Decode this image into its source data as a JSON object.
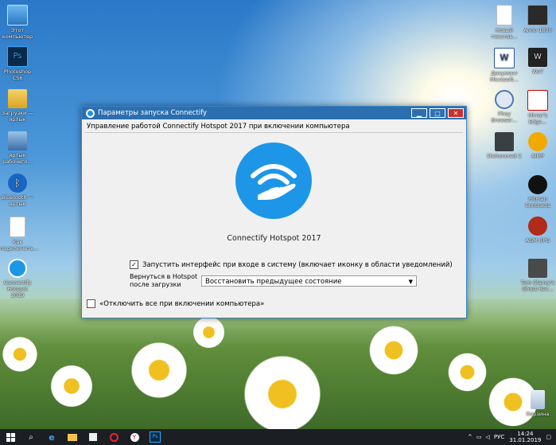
{
  "desktop": {
    "left_icons": [
      {
        "label": "Этот компьютер",
        "icon": "computer-icon"
      },
      {
        "label": "Photoshop CS6",
        "icon": "photoshop-icon"
      },
      {
        "label": "Загрузки — ярлык",
        "icon": "downloads-icon"
      },
      {
        "label": "ярлык рабочего…",
        "icon": "shortcut-icon"
      },
      {
        "label": "Bluetooth — ярлык",
        "icon": "bluetooth-icon"
      },
      {
        "label": "Как подключить…",
        "icon": "document-icon"
      },
      {
        "label": "Connectify Hotspot 2019",
        "icon": "connectify-icon"
      }
    ],
    "right_icons": [
      {
        "label": "Новый текстов…",
        "icon": "text-file-icon"
      },
      {
        "label": "Anno 1800",
        "icon": "game-icon"
      },
      {
        "label": "Документ Microsoft…",
        "icon": "word-icon"
      },
      {
        "label": "WoT",
        "icon": "game-icon"
      },
      {
        "label": "Phoy Browser…",
        "icon": "browser-icon"
      },
      {
        "label": "Mirror's Edge…",
        "icon": "game-icon"
      },
      {
        "label": "Dishonored 2",
        "icon": "game-icon"
      },
      {
        "label": "AIMP",
        "icon": "aimp-icon"
      },
      {
        "label": "Hitman Contracts",
        "icon": "game-icon"
      },
      {
        "label": "AGM RPG",
        "icon": "game-icon"
      },
      {
        "label": "Tom Clancy's Ghost Rec…",
        "icon": "game-icon"
      },
      {
        "label": "Корзина",
        "icon": "recycle-bin-icon"
      }
    ]
  },
  "dialog": {
    "title": "Параметры запуска Connectify",
    "minimize": "▁",
    "maximize": "□",
    "close": "✕",
    "heading": "Управление работой Connectify Hotspot 2017 при включении компьютера",
    "product_name": "Connectify Hotspot 2017",
    "launch_checkbox": {
      "checked": true,
      "label": "Запустить интерфейс при входе в систему (включает иконку в области уведомлений)"
    },
    "return_label": "Вернуться в Hotspot после загрузки",
    "return_select": {
      "value": "Восстановить предыдущее состояние"
    },
    "disable_checkbox": {
      "checked": false,
      "label": "«Отключить все при включении компьютера»"
    }
  },
  "taskbar": {
    "language": "РУС",
    "time": "14:24",
    "date": "31.01.2019"
  },
  "colors": {
    "title_bar": "#2c6fb0",
    "connectify_blue": "#1e96e8",
    "taskbar": "#1b1f24"
  }
}
